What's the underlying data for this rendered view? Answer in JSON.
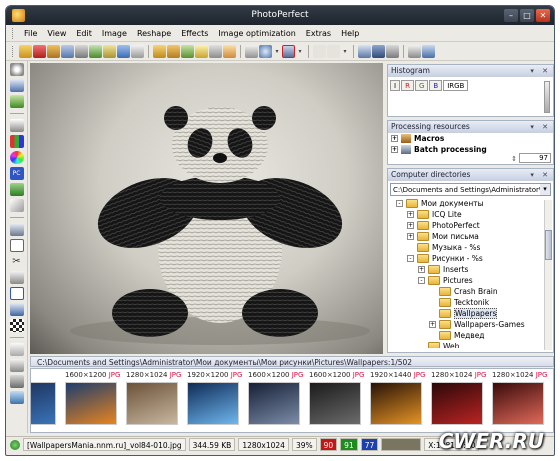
{
  "window": {
    "title": "PhotoPerfect"
  },
  "menu": [
    "File",
    "View",
    "Edit",
    "Image",
    "Reshape",
    "Effects",
    "Image optimization",
    "Extras",
    "Help"
  ],
  "histogram": {
    "title": "Histogram",
    "tabs": [
      "I",
      "R",
      "G",
      "B",
      "IRGB"
    ],
    "active_tab": "IRGB"
  },
  "processing": {
    "title": "Processing resources",
    "items": [
      "Macros",
      "Batch processing"
    ],
    "counter": "97"
  },
  "directories": {
    "title": "Computer directories",
    "path": "C:\\Documents and Settings\\Administrator\\Mon",
    "tree": [
      {
        "label": "Мои документы",
        "level": 1,
        "exp": "-"
      },
      {
        "label": "ICQ Lite",
        "level": 2,
        "exp": "+"
      },
      {
        "label": "PhotoPerfect",
        "level": 2,
        "exp": "+"
      },
      {
        "label": "Мои письма",
        "level": 2,
        "exp": "+"
      },
      {
        "label": "Музыка - %s",
        "level": 2,
        "exp": ""
      },
      {
        "label": "Рисунки - %s",
        "level": 2,
        "exp": "-"
      },
      {
        "label": "Inserts",
        "level": 3,
        "exp": "+"
      },
      {
        "label": "Pictures",
        "level": 3,
        "exp": "-"
      },
      {
        "label": "Crash Brain",
        "level": 4,
        "exp": ""
      },
      {
        "label": "Tecktonik",
        "level": 4,
        "exp": ""
      },
      {
        "label": "Wallpapers",
        "level": 4,
        "exp": "",
        "selected": true
      },
      {
        "label": "Wallpapers-Games",
        "level": 4,
        "exp": "+"
      },
      {
        "label": "Медвед",
        "level": 4,
        "exp": ""
      },
      {
        "label": "Web",
        "level": 3,
        "exp": ""
      }
    ]
  },
  "pathbar": "C:\\Documents and Settings\\Administrator\\Мои документы\\Мои рисунки\\Pictures\\Wallpapers:1/502",
  "thumbnails": [
    {
      "size": "0 JPG",
      "colors": [
        "#1a2a52",
        "#3a74b8"
      ]
    },
    {
      "size": "1600×1200",
      "colors": [
        "#1d3d6e",
        "#e88420"
      ]
    },
    {
      "size": "1280×1024",
      "colors": [
        "#6b5238",
        "#c9b7a1"
      ]
    },
    {
      "size": "1920×1200",
      "colors": [
        "#0f2b57",
        "#6fb7ee"
      ]
    },
    {
      "size": "1600×1200",
      "colors": [
        "#162036",
        "#7c8ca8"
      ]
    },
    {
      "size": "1600×1200",
      "colors": [
        "#1b1b1b",
        "#6b6b6b"
      ]
    },
    {
      "size": "1920×1440",
      "colors": [
        "#281208",
        "#e59425"
      ]
    },
    {
      "size": "1280×1024",
      "colors": [
        "#2b0808",
        "#bb2424"
      ]
    },
    {
      "size": "1280×1024",
      "colors": [
        "#3a0a0a",
        "#e06a5a"
      ]
    }
  ],
  "thumb_suffix": "JPG",
  "status": {
    "filename": "[WallpapersMania.nnm.ru]_vol84-010.jpg",
    "filesize": "344.59 KB",
    "dimensions": "1280x1024",
    "zoom": "39%",
    "r": "90",
    "g": "91",
    "b": "77",
    "coords": "X:1081, Y:10"
  },
  "watermark": "CWER.RU"
}
